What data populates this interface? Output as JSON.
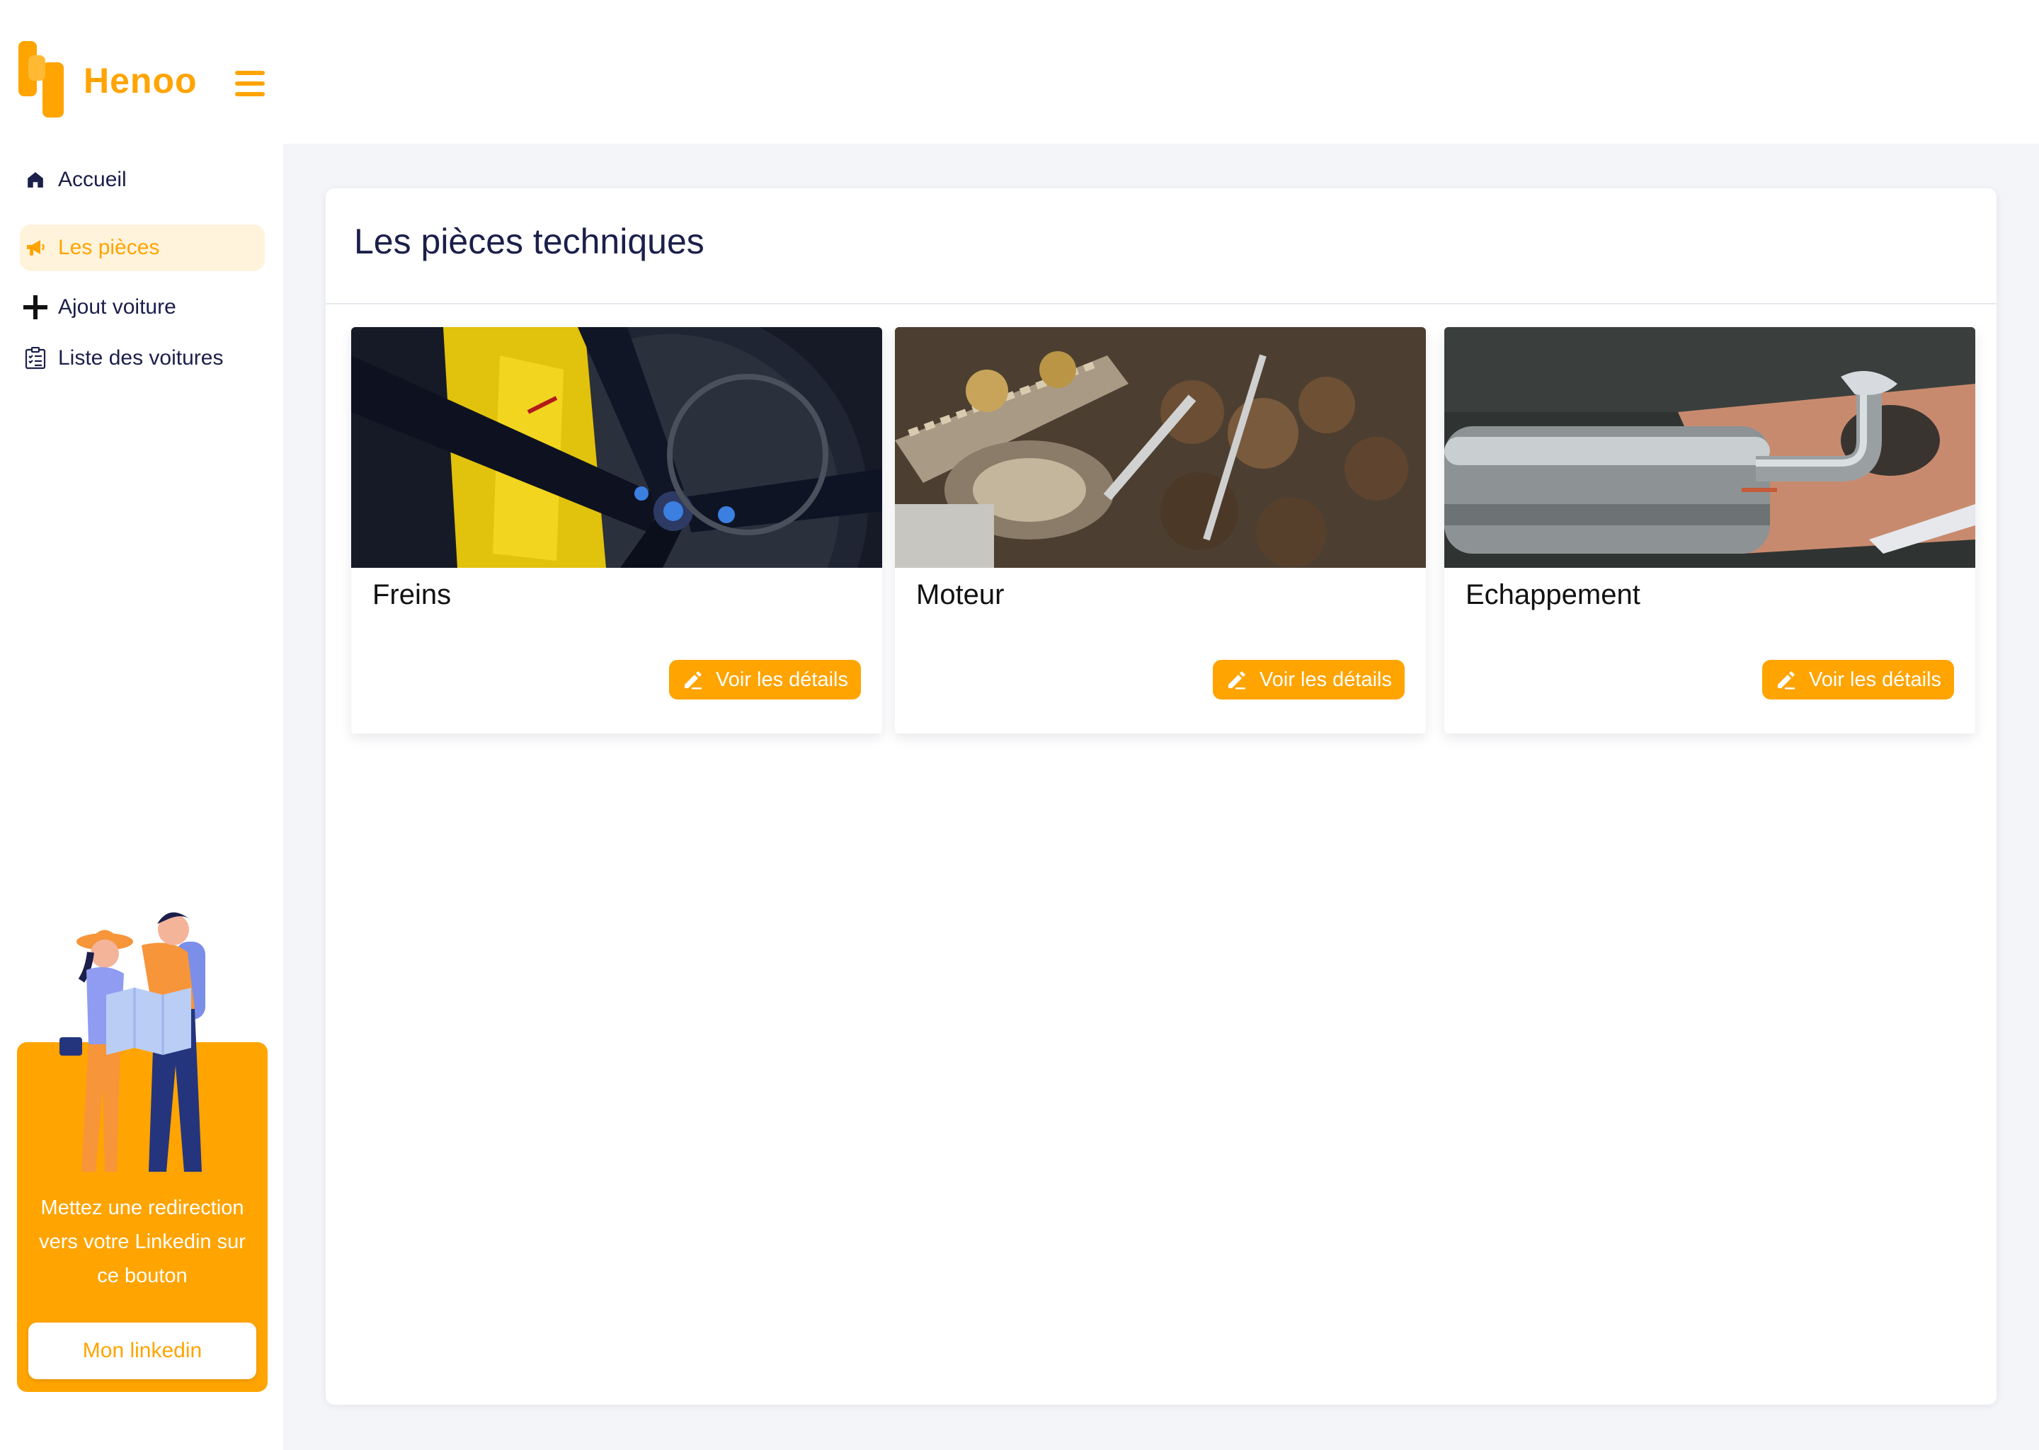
{
  "app": {
    "brand": "Henoo",
    "accent_color": "#ffa400",
    "text_color": "#1b1f4a"
  },
  "header": {
    "menu_icon": "hamburger-icon"
  },
  "sidebar": {
    "items": [
      {
        "label": "Accueil",
        "icon": "home-icon",
        "active": false
      },
      {
        "label": "Les pièces",
        "icon": "megaphone-icon",
        "active": true
      },
      {
        "label": "Ajout voiture",
        "icon": "plus-icon",
        "active": false
      },
      {
        "label": "Liste des voitures",
        "icon": "checklist-icon",
        "active": false
      }
    ],
    "promo": {
      "text": "Mettez une redirection vers votre Linkedin sur ce bouton",
      "button_label": "Mon linkedin"
    }
  },
  "main": {
    "title": "Les pièces techniques",
    "cards": [
      {
        "title": "Freins",
        "button_label": "Voir les détails",
        "image": "brake-caliper-photo"
      },
      {
        "title": "Moteur",
        "button_label": "Voir les détails",
        "image": "engine-photo"
      },
      {
        "title": "Echappement",
        "button_label": "Voir les détails",
        "image": "exhaust-photo"
      }
    ]
  }
}
